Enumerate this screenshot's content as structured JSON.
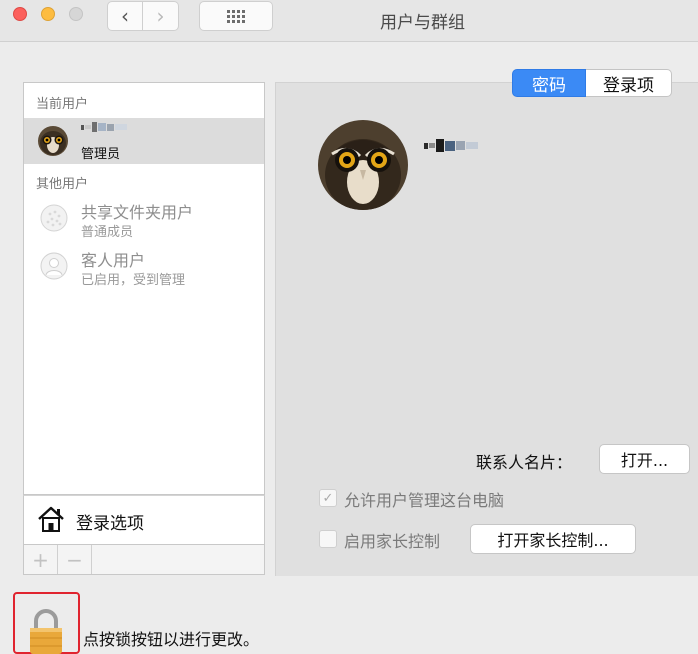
{
  "window": {
    "title": "用户与群组"
  },
  "colors": {
    "accent": "#3b8af5",
    "highlight_box": "#e0242f"
  },
  "icons": {
    "close": "red-close-dot",
    "minimize": "yellow-minimize-dot",
    "zoom": "gray-zoom-dot",
    "back": "chevron-left-icon",
    "forward": "chevron-right-icon",
    "grid": "grid-icon",
    "login": "house-icon",
    "lock": "lock-icon"
  },
  "toolbar": {
    "back_glyph": "‹",
    "forward_glyph": "›"
  },
  "sidebar": {
    "current_users_header": "当前用户",
    "current_user": {
      "role": "管理员"
    },
    "other_users_header": "其他用户",
    "other_users": [
      {
        "name": "共享文件夹用户",
        "role": "普通成员"
      },
      {
        "name": "客人用户",
        "role": "已启用，受到管理"
      }
    ],
    "login_options_label": "登录选项",
    "add_glyph": "+",
    "remove_glyph": "−"
  },
  "tabs": {
    "password": "密码",
    "login_items": "登录项"
  },
  "main": {
    "contact_card_label": "联系人名片：",
    "open_button": "打开...",
    "allow_admin_checked_glyph": "✓",
    "allow_admin_label": "允许用户管理这台电脑",
    "parental_label": "启用家长控制",
    "parental_button": "打开家长控制..."
  },
  "footer": {
    "lock_text": "点按锁按钮以进行更改。"
  }
}
